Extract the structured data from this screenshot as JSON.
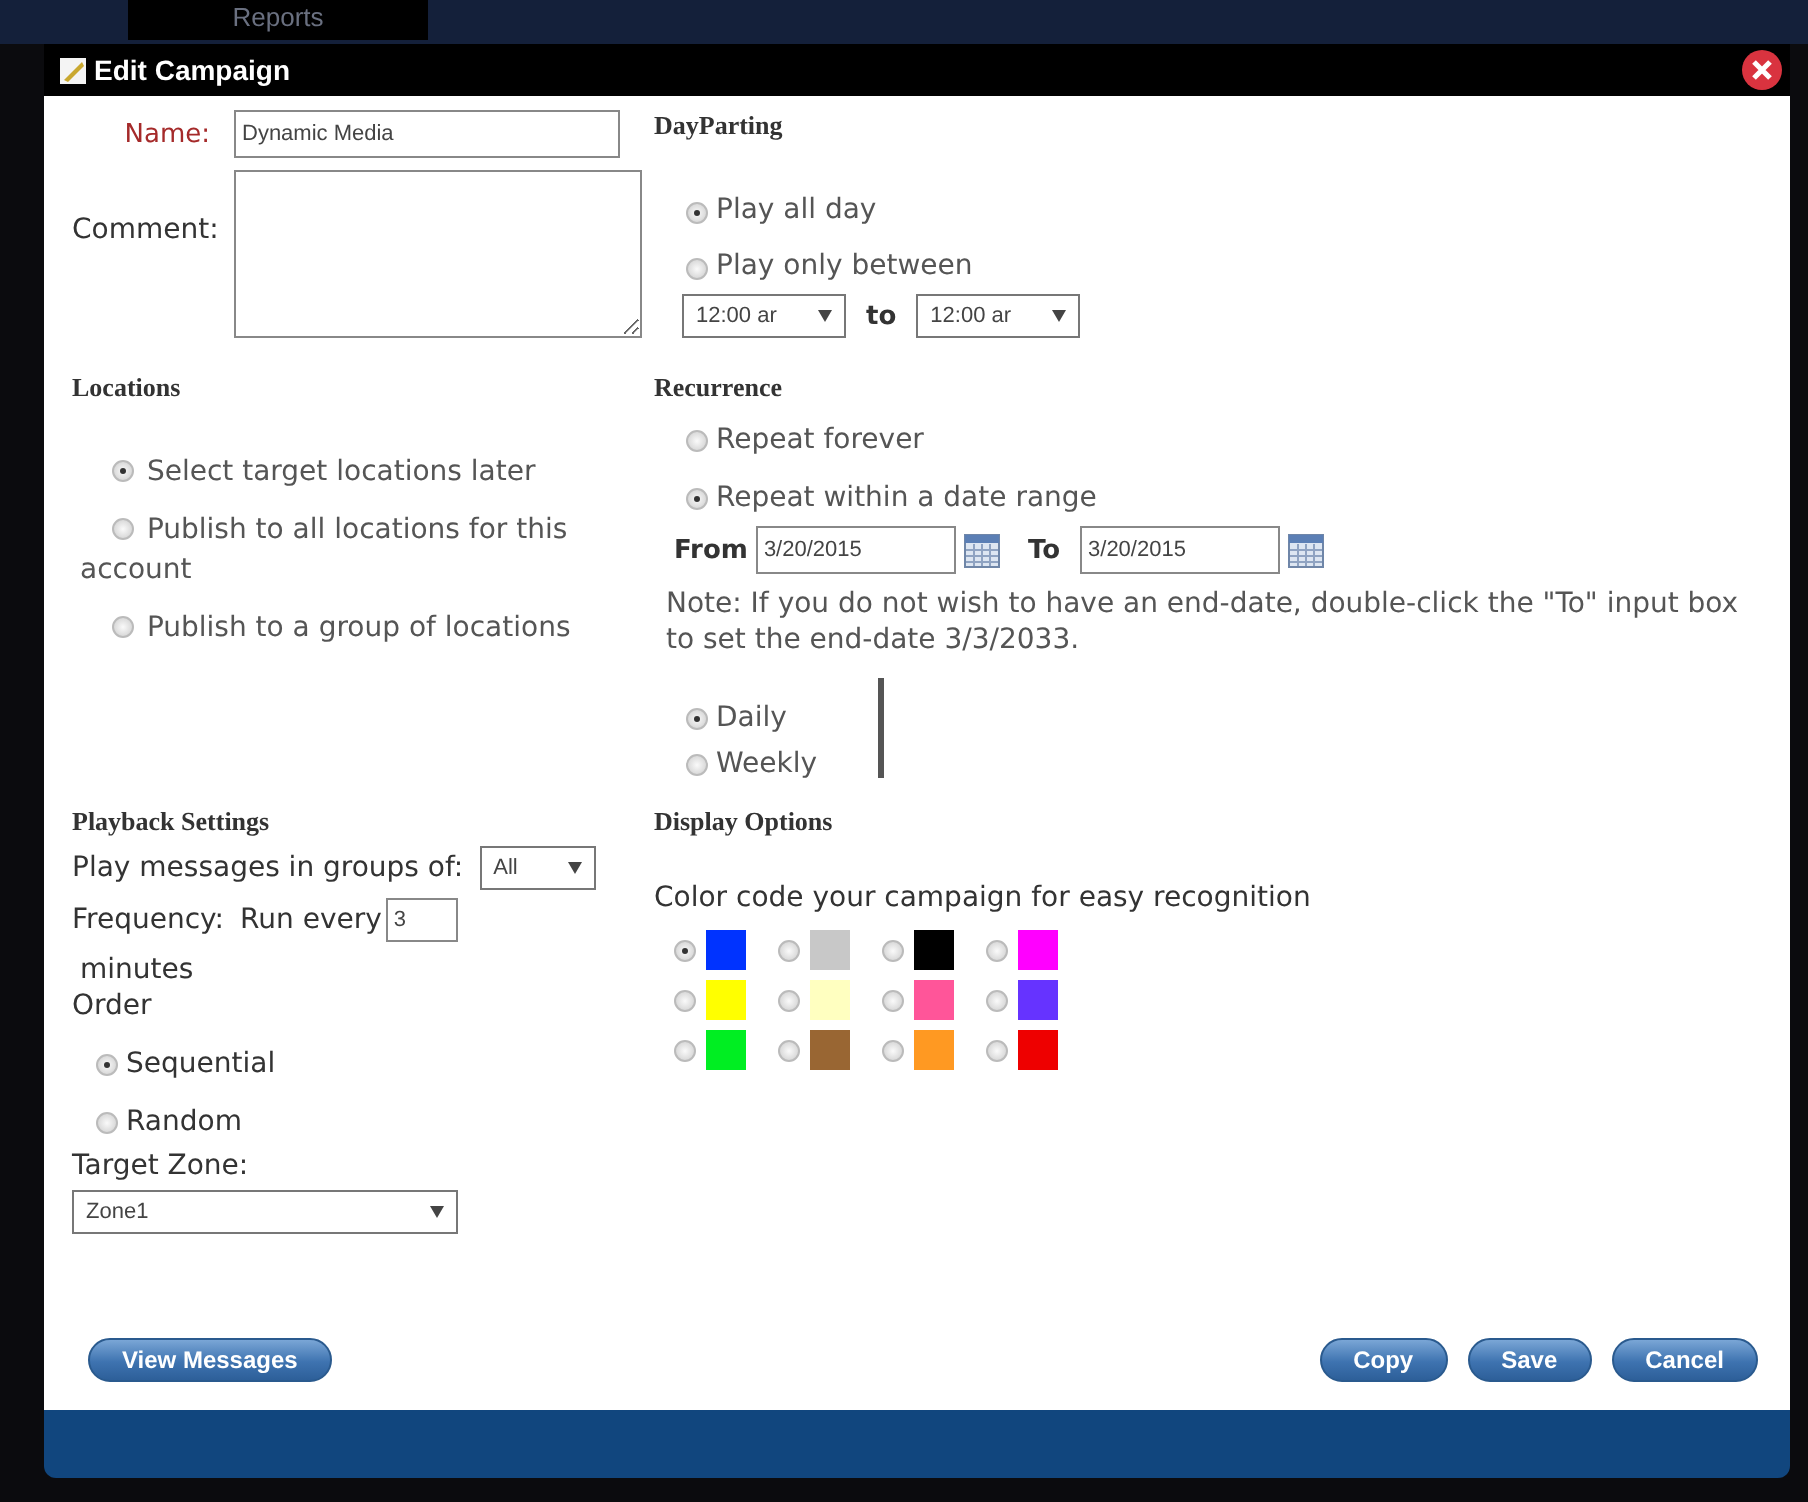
{
  "background_tab": "Reports",
  "window": {
    "title": "Edit Campaign"
  },
  "name": {
    "label": "Name:",
    "value": "Dynamic Media"
  },
  "comment": {
    "label": "Comment:"
  },
  "dayparting": {
    "title": "DayParting",
    "options": [
      {
        "label": "Play all day",
        "selected": true
      },
      {
        "label": "Play only between",
        "selected": false
      }
    ],
    "from_time": "12:00 ar",
    "to_label": "to",
    "to_time": "12:00 ar"
  },
  "locations": {
    "title": "Locations",
    "options": [
      {
        "label": "Select target locations later",
        "selected": true
      },
      {
        "label": "Publish to all locations for this account",
        "selected": false
      },
      {
        "label": "Publish to a group of locations",
        "selected": false
      }
    ]
  },
  "recurrence": {
    "title": "Recurrence",
    "options": [
      {
        "label": "Repeat forever",
        "selected": false
      },
      {
        "label": "Repeat within a date range",
        "selected": true
      }
    ],
    "from_label": "From",
    "from_value": "3/20/2015",
    "to_label": "To",
    "to_value": "3/20/2015",
    "note": "Note: If you do not wish to have an end-date, double-click the \"To\" input box to set the end-date 3/3/2033.",
    "periods": [
      {
        "label": "Daily",
        "selected": true
      },
      {
        "label": "Weekly",
        "selected": false
      }
    ]
  },
  "playback": {
    "title": "Playback Settings",
    "groups_label": "Play messages in groups of:",
    "groups_value": "All",
    "frequency_label": "Frequency:",
    "run_every_label": "Run every",
    "run_every_value": "3",
    "minutes_label": "minutes",
    "order_label": "Order",
    "order_options": [
      {
        "label": "Sequential",
        "selected": true
      },
      {
        "label": "Random",
        "selected": false
      }
    ],
    "target_zone_label": "Target Zone:",
    "target_zone_value": "Zone1"
  },
  "display": {
    "title": "Display Options",
    "caption": "Color code your campaign for easy recognition",
    "colors": [
      {
        "color": "#0033ff",
        "selected": true
      },
      {
        "color": "#c8c8c8",
        "selected": false
      },
      {
        "color": "#000000",
        "selected": false
      },
      {
        "color": "#ff00ff",
        "selected": false
      },
      {
        "color": "#ffff00",
        "selected": false
      },
      {
        "color": "#ffffc0",
        "selected": false
      },
      {
        "color": "#ff5599",
        "selected": false
      },
      {
        "color": "#6633ff",
        "selected": false
      },
      {
        "color": "#00ee22",
        "selected": false
      },
      {
        "color": "#996633",
        "selected": false
      },
      {
        "color": "#ff9922",
        "selected": false
      },
      {
        "color": "#ee0000",
        "selected": false
      }
    ]
  },
  "left_button": "View Messages",
  "buttons": [
    "Copy",
    "Save",
    "Cancel"
  ]
}
